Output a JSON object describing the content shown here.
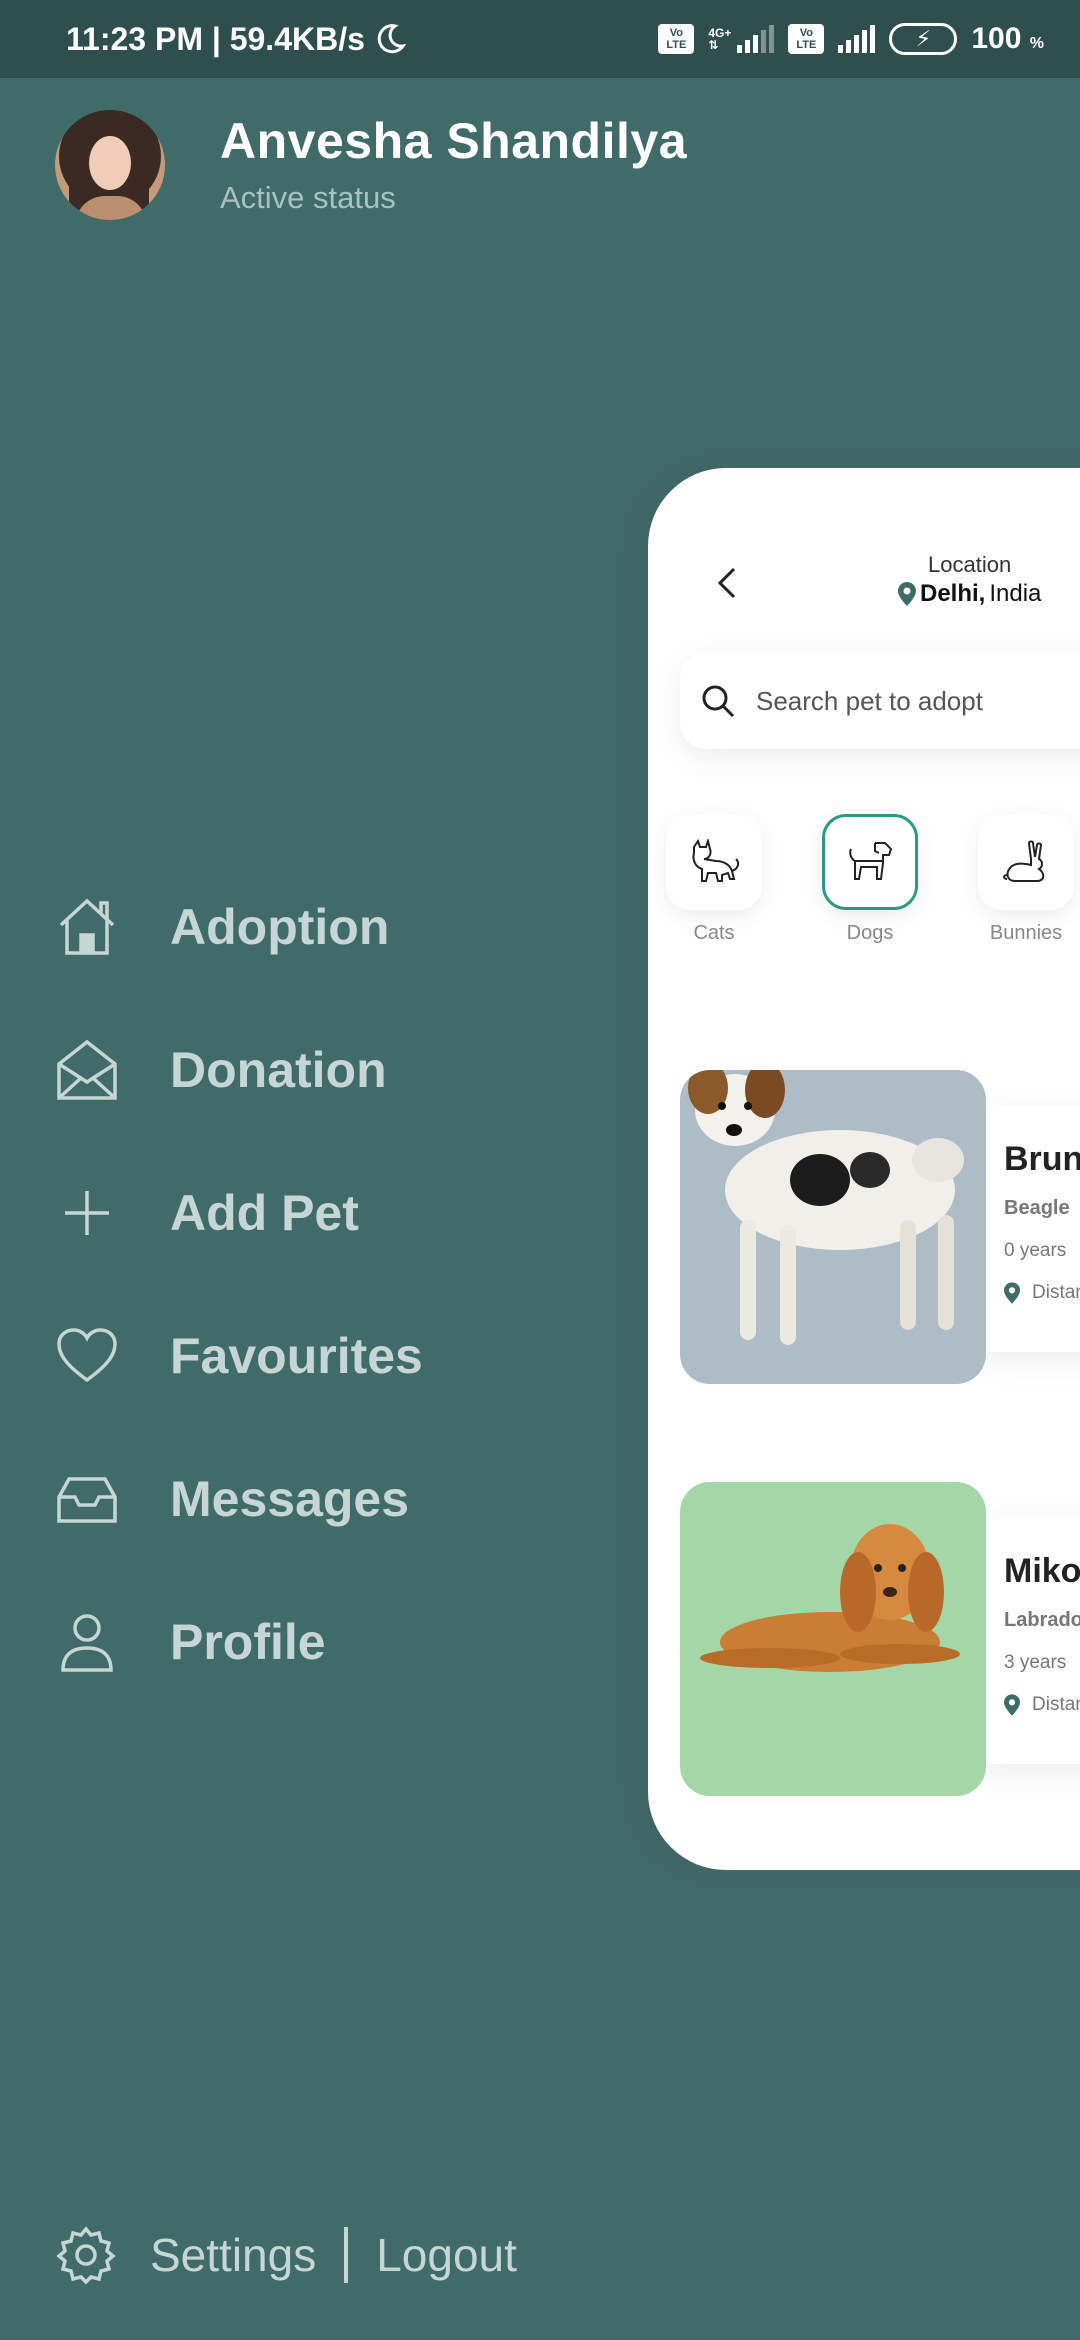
{
  "status_bar": {
    "time_speed": "11:23 PM | 59.4KB/s",
    "network": "4G+",
    "volte": "Vo LTE",
    "battery": "100",
    "battery_unit": "%"
  },
  "profile": {
    "name": "Anvesha Shandilya",
    "status": "Active status"
  },
  "menu": {
    "items": [
      {
        "label": "Adoption",
        "icon": "home-icon"
      },
      {
        "label": "Donation",
        "icon": "envelope-open-icon"
      },
      {
        "label": "Add Pet",
        "icon": "plus-icon"
      },
      {
        "label": "Favourites",
        "icon": "heart-icon"
      },
      {
        "label": "Messages",
        "icon": "inbox-icon"
      },
      {
        "label": "Profile",
        "icon": "user-icon"
      }
    ]
  },
  "footer": {
    "settings": "Settings",
    "logout": "Logout"
  },
  "app_preview": {
    "location_title": "Location",
    "location_city": "Delhi,",
    "location_country": " India",
    "search_placeholder": "Search pet to adopt",
    "categories": [
      {
        "label": "Cats",
        "icon": "cat-icon",
        "active": false
      },
      {
        "label": "Dogs",
        "icon": "dog-icon",
        "active": true
      },
      {
        "label": "Bunnies",
        "icon": "rabbit-icon",
        "active": false
      }
    ],
    "pets": [
      {
        "name": "Bruno",
        "breed": "Beagle",
        "age": "0 years",
        "distance": "Distance",
        "bg": "#aebcc5"
      },
      {
        "name": "Miko",
        "breed": "Labrador",
        "age": "3 years",
        "distance": "Distance",
        "bg": "#a5d6a7"
      }
    ]
  },
  "colors": {
    "background": "#416b69",
    "status_bar": "#2f4f4e",
    "menu_text": "#c5d6d4",
    "accent": "#2b9a84"
  }
}
